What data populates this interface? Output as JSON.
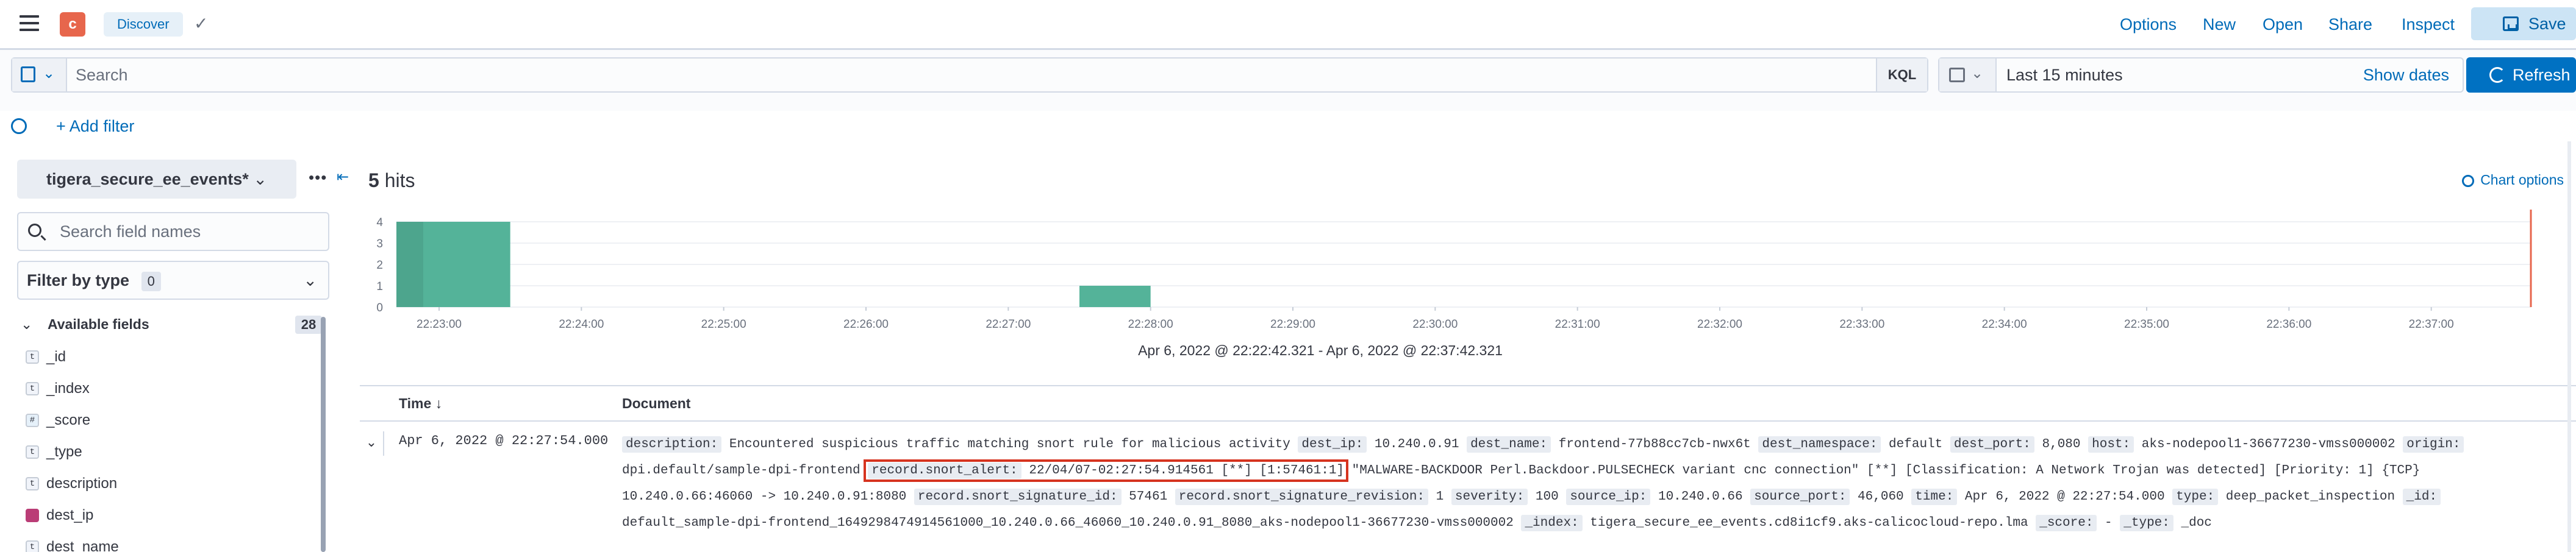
{
  "header": {
    "space_initial": "c",
    "breadcrumb": "Discover",
    "links": [
      "Options",
      "New",
      "Open",
      "Share",
      "Inspect"
    ],
    "save_label": "Save"
  },
  "query": {
    "search_placeholder": "Search",
    "language": "KQL",
    "time_range": "Last 15 minutes",
    "show_dates": "Show dates",
    "refresh": "Refresh"
  },
  "filters": {
    "add_filter": "+ Add filter"
  },
  "sidebar": {
    "index_pattern": "tigera_secure_ee_events*",
    "search_placeholder": "Search field names",
    "filter_by_type": "Filter by type",
    "filter_count": "0",
    "available_fields_label": "Available fields",
    "available_count": "28",
    "fields": [
      {
        "type": "t",
        "name": "_id"
      },
      {
        "type": "t",
        "name": "_index"
      },
      {
        "type": "#",
        "name": "_score"
      },
      {
        "type": "t",
        "name": "_type"
      },
      {
        "type": "t",
        "name": "description"
      },
      {
        "type": "ip",
        "name": "dest_ip"
      },
      {
        "type": "t",
        "name": "dest_name"
      }
    ]
  },
  "main": {
    "hits_count": "5",
    "hits_label": "hits",
    "chart_options": "Chart options",
    "time_range_label": "Apr 6, 2022 @ 22:22:42.321 - Apr 6, 2022 @ 22:37:42.321",
    "col_time": "Time",
    "col_document": "Document",
    "sort_arrow": "↓"
  },
  "chart_data": {
    "type": "bar",
    "x_ticks": [
      "22:23:00",
      "22:24:00",
      "22:25:00",
      "22:26:00",
      "22:27:00",
      "22:28:00",
      "22:29:00",
      "22:30:00",
      "22:31:00",
      "22:32:00",
      "22:33:00",
      "22:34:00",
      "22:35:00",
      "22:36:00",
      "22:37:00"
    ],
    "y_ticks": [
      "0",
      "1",
      "2",
      "3",
      "4"
    ],
    "ylim": [
      0,
      4
    ],
    "bars": [
      {
        "start": "22:22:42",
        "end": "22:23:30",
        "value": 4
      },
      {
        "start": "22:27:30",
        "end": "22:28:00",
        "value": 1
      }
    ],
    "color": "#54b399"
  },
  "document": {
    "time": "Apr 6, 2022 @ 22:27:54.000",
    "fields": [
      {
        "k": "description:",
        "v": "Encountered suspicious traffic matching snort rule for malicious activity"
      },
      {
        "k": "dest_ip:",
        "v": "10.240.0.91"
      },
      {
        "k": "dest_name:",
        "v": "frontend-77b88cc7cb-nwx6t"
      },
      {
        "k": "dest_namespace:",
        "v": "default"
      },
      {
        "k": "dest_port:",
        "v": "8,080"
      },
      {
        "k": "host:",
        "v": "aks-nodepool1-36677230-vmss000002"
      },
      {
        "k": "origin:",
        "v": "dpi.default/sample-dpi-frontend"
      },
      {
        "k": "record.snort_alert:",
        "v": "22/04/07-02:27:54.914561 [**] [1:57461:1]",
        "highlight": true
      },
      {
        "k": "",
        "v": "\"MALWARE-BACKDOOR Perl.Backdoor.PULSECHECK variant cnc connection\" [**] [Classification: A Network Trojan was detected] [Priority: 1] {TCP} 10.240.0.66:46060 -> 10.240.0.91:8080"
      },
      {
        "k": "record.snort_signature_id:",
        "v": "57461"
      },
      {
        "k": "record.snort_signature_revision:",
        "v": "1"
      },
      {
        "k": "severity:",
        "v": "100"
      },
      {
        "k": "source_ip:",
        "v": "10.240.0.66"
      },
      {
        "k": "source_port:",
        "v": "46,060"
      },
      {
        "k": "time:",
        "v": "Apr 6, 2022 @ 22:27:54.000"
      },
      {
        "k": "type:",
        "v": "deep_packet_inspection"
      },
      {
        "k": "_id:",
        "v": "default_sample-dpi-frontend_1649298474914561000_10.240.0.66_46060_10.240.0.91_8080_aks-nodepool1-36677230-vmss000002"
      },
      {
        "k": "_index:",
        "v": "tigera_secure_ee_events.cd8i1cf9.aks-calicocloud-repo.lma"
      },
      {
        "k": "_score:",
        "v": " - "
      },
      {
        "k": "_type:",
        "v": "_doc"
      }
    ]
  },
  "colors": {
    "link": "#006bb8",
    "refresh_bg": "#0071c2",
    "space_badge": "#e7664c",
    "bar": "#54b399",
    "highlight": "#d6331f"
  }
}
